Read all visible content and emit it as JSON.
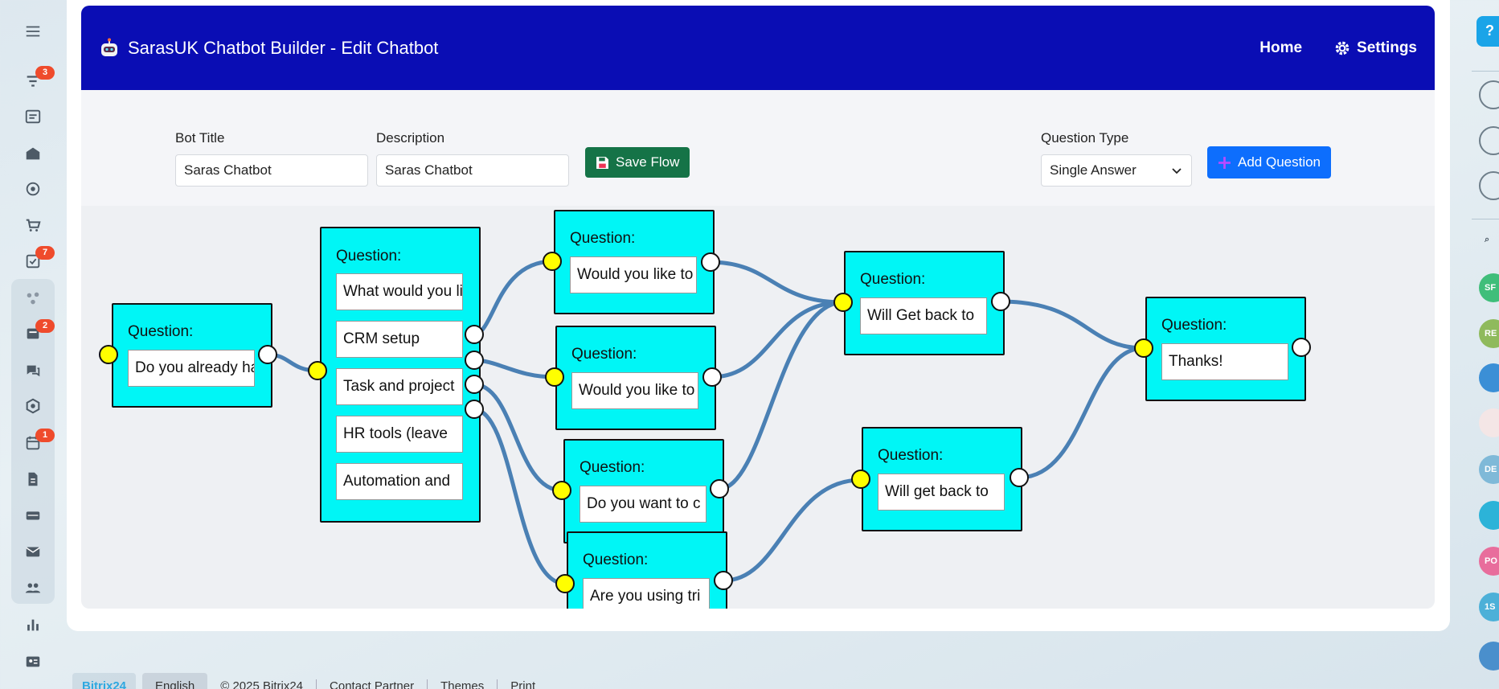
{
  "app": {
    "title": "SarasUK Chatbot Builder - Edit Chatbot",
    "brand_icon": "robot-icon"
  },
  "nav": {
    "home_label": "Home",
    "settings_label": "Settings"
  },
  "form": {
    "bot_title_label": "Bot Title",
    "bot_title_value": "Saras Chatbot",
    "description_label": "Description",
    "description_value": "Saras Chatbot",
    "save_label": "Save Flow",
    "question_type_label": "Question Type",
    "question_type_value": "Single Answer",
    "add_question_label": "Add Question"
  },
  "nodes": [
    {
      "label": "Question:",
      "text": "Do you already have"
    },
    {
      "label": "Question:",
      "text": "What would you like",
      "options": [
        "CRM setup",
        "Task and project",
        "HR tools (leave",
        "Automation and"
      ]
    },
    {
      "label": "Question:",
      "text": "Would you like to"
    },
    {
      "label": "Question:",
      "text": "Would you like to"
    },
    {
      "label": "Question:",
      "text": "Do you want to c"
    },
    {
      "label": "Question:",
      "text": "Are you using tri"
    },
    {
      "label": "Question:",
      "text": "Will Get back to"
    },
    {
      "label": "Question:",
      "text": "Will get back to"
    },
    {
      "label": "Question:",
      "text": "Thanks!"
    }
  ],
  "sidebar_badges": {
    "filter": "3",
    "tasks": "7",
    "inbox": "2",
    "calendar": "1"
  },
  "right_rail_avatars": [
    "SF",
    "RE",
    "DE",
    "PO",
    "1S"
  ],
  "footer": {
    "logo": "Bitrix24",
    "language": "English",
    "copyright": "© 2025 Bitrix24",
    "contact": "Contact Partner",
    "themes": "Themes",
    "print": "Print"
  },
  "colors": {
    "header": "#0a0db4",
    "node": "#00f6f6",
    "link": "#4a80b4",
    "save": "#157347",
    "add": "#0d6efd"
  }
}
